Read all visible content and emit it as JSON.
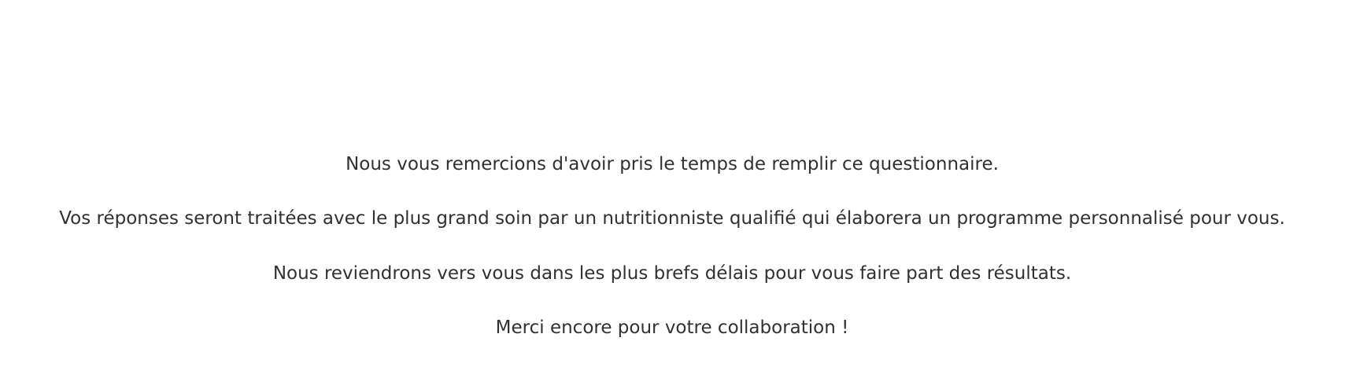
{
  "message": {
    "line1": "Nous vous remercions d'avoir pris le temps de remplir ce questionnaire.",
    "line2": "Vos réponses seront traitées avec le plus grand soin par un nutritionniste qualifié qui élaborera un programme personnalisé pour vous.",
    "line3": "Nous reviendrons vers vous dans les plus brefs délais pour vous faire part des résultats.",
    "line4": "Merci encore pour votre collaboration !"
  },
  "colors": {
    "background": "#ffffff",
    "text": "#2f3133"
  }
}
